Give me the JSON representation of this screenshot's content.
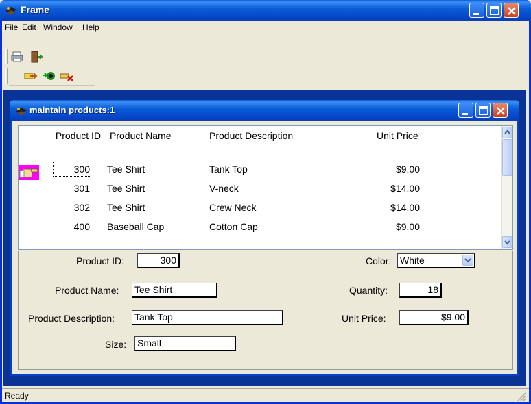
{
  "window": {
    "title": "Frame"
  },
  "menu": [
    "File",
    "Edit",
    "Window",
    "Help"
  ],
  "toolbar1": {
    "icons": [
      "print-icon",
      "exit-door-icon"
    ]
  },
  "toolbar2": {
    "icons": [
      "insert-row-icon",
      "retrieve-icon",
      "delete-row-icon"
    ]
  },
  "child": {
    "title": "maintain products:1"
  },
  "grid": {
    "columns": [
      "Product ID",
      "Product Name",
      "Product Description",
      "Unit Price"
    ],
    "rows": [
      {
        "id": "300",
        "name": "Tee Shirt",
        "description": "Tank Top",
        "price": "$9.00"
      },
      {
        "id": "301",
        "name": "Tee Shirt",
        "description": "V-neck",
        "price": "$14.00"
      },
      {
        "id": "302",
        "name": "Tee Shirt",
        "description": "Crew Neck",
        "price": "$14.00"
      },
      {
        "id": "400",
        "name": "Baseball Cap",
        "description": "Cotton Cap",
        "price": "$9.00"
      }
    ]
  },
  "form": {
    "product_id_label": "Product ID:",
    "product_id": "300",
    "product_name_label": "Product Name:",
    "product_name": "Tee Shirt",
    "product_description_label": "Product Description:",
    "product_description": "Tank Top",
    "size_label": "Size:",
    "size": "Small",
    "color_label": "Color:",
    "color": "White",
    "quantity_label": "Quantity:",
    "quantity": "18",
    "unit_price_label": "Unit Price:",
    "unit_price": "$9.00"
  },
  "status": {
    "text": "Ready"
  },
  "colors": {
    "title_blue": "#0a5fd8",
    "row_indicator": "#ff00ff",
    "mdi_background": "#0a3396"
  }
}
